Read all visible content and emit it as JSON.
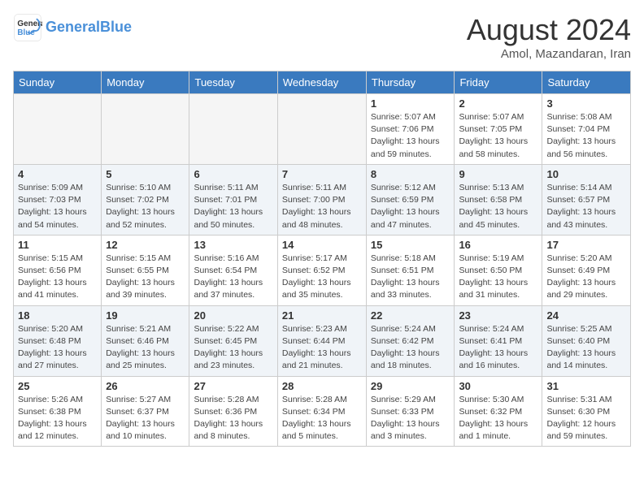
{
  "logo": {
    "line1": "General",
    "line2": "Blue"
  },
  "title": "August 2024",
  "subtitle": "Amol, Mazandaran, Iran",
  "days_of_week": [
    "Sunday",
    "Monday",
    "Tuesday",
    "Wednesday",
    "Thursday",
    "Friday",
    "Saturday"
  ],
  "weeks": [
    [
      {
        "day": "",
        "info": ""
      },
      {
        "day": "",
        "info": ""
      },
      {
        "day": "",
        "info": ""
      },
      {
        "day": "",
        "info": ""
      },
      {
        "day": "1",
        "info": "Sunrise: 5:07 AM\nSunset: 7:06 PM\nDaylight: 13 hours\nand 59 minutes."
      },
      {
        "day": "2",
        "info": "Sunrise: 5:07 AM\nSunset: 7:05 PM\nDaylight: 13 hours\nand 58 minutes."
      },
      {
        "day": "3",
        "info": "Sunrise: 5:08 AM\nSunset: 7:04 PM\nDaylight: 13 hours\nand 56 minutes."
      }
    ],
    [
      {
        "day": "4",
        "info": "Sunrise: 5:09 AM\nSunset: 7:03 PM\nDaylight: 13 hours\nand 54 minutes."
      },
      {
        "day": "5",
        "info": "Sunrise: 5:10 AM\nSunset: 7:02 PM\nDaylight: 13 hours\nand 52 minutes."
      },
      {
        "day": "6",
        "info": "Sunrise: 5:11 AM\nSunset: 7:01 PM\nDaylight: 13 hours\nand 50 minutes."
      },
      {
        "day": "7",
        "info": "Sunrise: 5:11 AM\nSunset: 7:00 PM\nDaylight: 13 hours\nand 48 minutes."
      },
      {
        "day": "8",
        "info": "Sunrise: 5:12 AM\nSunset: 6:59 PM\nDaylight: 13 hours\nand 47 minutes."
      },
      {
        "day": "9",
        "info": "Sunrise: 5:13 AM\nSunset: 6:58 PM\nDaylight: 13 hours\nand 45 minutes."
      },
      {
        "day": "10",
        "info": "Sunrise: 5:14 AM\nSunset: 6:57 PM\nDaylight: 13 hours\nand 43 minutes."
      }
    ],
    [
      {
        "day": "11",
        "info": "Sunrise: 5:15 AM\nSunset: 6:56 PM\nDaylight: 13 hours\nand 41 minutes."
      },
      {
        "day": "12",
        "info": "Sunrise: 5:15 AM\nSunset: 6:55 PM\nDaylight: 13 hours\nand 39 minutes."
      },
      {
        "day": "13",
        "info": "Sunrise: 5:16 AM\nSunset: 6:54 PM\nDaylight: 13 hours\nand 37 minutes."
      },
      {
        "day": "14",
        "info": "Sunrise: 5:17 AM\nSunset: 6:52 PM\nDaylight: 13 hours\nand 35 minutes."
      },
      {
        "day": "15",
        "info": "Sunrise: 5:18 AM\nSunset: 6:51 PM\nDaylight: 13 hours\nand 33 minutes."
      },
      {
        "day": "16",
        "info": "Sunrise: 5:19 AM\nSunset: 6:50 PM\nDaylight: 13 hours\nand 31 minutes."
      },
      {
        "day": "17",
        "info": "Sunrise: 5:20 AM\nSunset: 6:49 PM\nDaylight: 13 hours\nand 29 minutes."
      }
    ],
    [
      {
        "day": "18",
        "info": "Sunrise: 5:20 AM\nSunset: 6:48 PM\nDaylight: 13 hours\nand 27 minutes."
      },
      {
        "day": "19",
        "info": "Sunrise: 5:21 AM\nSunset: 6:46 PM\nDaylight: 13 hours\nand 25 minutes."
      },
      {
        "day": "20",
        "info": "Sunrise: 5:22 AM\nSunset: 6:45 PM\nDaylight: 13 hours\nand 23 minutes."
      },
      {
        "day": "21",
        "info": "Sunrise: 5:23 AM\nSunset: 6:44 PM\nDaylight: 13 hours\nand 21 minutes."
      },
      {
        "day": "22",
        "info": "Sunrise: 5:24 AM\nSunset: 6:42 PM\nDaylight: 13 hours\nand 18 minutes."
      },
      {
        "day": "23",
        "info": "Sunrise: 5:24 AM\nSunset: 6:41 PM\nDaylight: 13 hours\nand 16 minutes."
      },
      {
        "day": "24",
        "info": "Sunrise: 5:25 AM\nSunset: 6:40 PM\nDaylight: 13 hours\nand 14 minutes."
      }
    ],
    [
      {
        "day": "25",
        "info": "Sunrise: 5:26 AM\nSunset: 6:38 PM\nDaylight: 13 hours\nand 12 minutes."
      },
      {
        "day": "26",
        "info": "Sunrise: 5:27 AM\nSunset: 6:37 PM\nDaylight: 13 hours\nand 10 minutes."
      },
      {
        "day": "27",
        "info": "Sunrise: 5:28 AM\nSunset: 6:36 PM\nDaylight: 13 hours\nand 8 minutes."
      },
      {
        "day": "28",
        "info": "Sunrise: 5:28 AM\nSunset: 6:34 PM\nDaylight: 13 hours\nand 5 minutes."
      },
      {
        "day": "29",
        "info": "Sunrise: 5:29 AM\nSunset: 6:33 PM\nDaylight: 13 hours\nand 3 minutes."
      },
      {
        "day": "30",
        "info": "Sunrise: 5:30 AM\nSunset: 6:32 PM\nDaylight: 13 hours\nand 1 minute."
      },
      {
        "day": "31",
        "info": "Sunrise: 5:31 AM\nSunset: 6:30 PM\nDaylight: 12 hours\nand 59 minutes."
      }
    ]
  ]
}
